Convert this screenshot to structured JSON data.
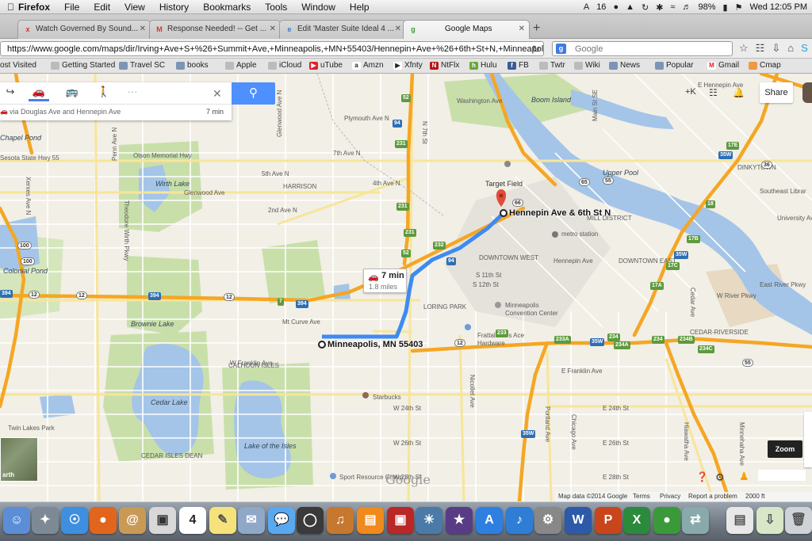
{
  "menubar": {
    "app": "Firefox",
    "items": [
      "File",
      "Edit",
      "View",
      "History",
      "Bookmarks",
      "Tools",
      "Window",
      "Help"
    ],
    "status": {
      "num": "16",
      "battery": "98%",
      "clock": "Wed 12:05 PM"
    }
  },
  "tabs": [
    {
      "label": "Watch Governed By Sound...",
      "fav": "x"
    },
    {
      "label": "Response Needed! -- Get ...",
      "fav": "M"
    },
    {
      "label": "Edit 'Master Suite Ideal 4 ...",
      "fav": "e"
    },
    {
      "label": "Google Maps",
      "fav": "g"
    }
  ],
  "nav": {
    "url": "https://www.google.com/maps/dir/Irving+Ave+S+%26+Summit+Ave,+Minneapolis,+MN+55403/Hennepin+Ave+%26+6th+St+N,+Minneapolis",
    "search_placeholder": "Google"
  },
  "bookmarks": [
    "ost Visited",
    "Getting Started",
    "Travel SC",
    "books",
    "Apple",
    "iCloud",
    "uTube",
    "Amzn",
    "Xfnty",
    "NtFlx",
    "Hulu",
    "FB",
    "Twtr",
    "Wiki",
    "News",
    "Popular",
    "Gmail",
    "Cmap"
  ],
  "directions": {
    "via": "via Douglas Ave and Hennepin Ave",
    "time": "7 min",
    "search_label": "Search"
  },
  "top_controls": {
    "plusk": "+K",
    "share": "Share"
  },
  "bubble": {
    "time": "7 min",
    "distance": "1.8 miles"
  },
  "markers": {
    "origin": "Minneapolis, MN 55403",
    "destination": "Hennepin Ave & 6th St N"
  },
  "places": {
    "areas": [
      "Boom Island",
      "Upper Pool",
      "Target Field",
      "metro station",
      "MILL DISTRICT",
      "DOWNTOWN WEST",
      "DOWNTOWN EAST",
      "LORING PARK",
      "Minneapolis Convention Center",
      "Frattallone's Ace Hardware",
      "Starbucks",
      "Sport Resource Group",
      "Cedar Lake",
      "Lake of the Isles",
      "Brownie Lake",
      "Wirth Lake",
      "Colonial Pond",
      "Twin Lakes Park",
      "DINKYTOWN",
      "Southeast Librar",
      "CEDAR-RIVERSIDE",
      "CALHOUN ISLES",
      "CEDAR ISLES DEAN",
      "HARRISON",
      "University Ave",
      "East River Pkwy",
      "W River Pkwy"
    ],
    "streets": [
      "Olson Memorial Hwy",
      "Glenwood Ave",
      "2nd Ave N",
      "4th Ave N",
      "5th Ave N",
      "7th Ave N",
      "Mt Curve Ave",
      "W Franklin Ave",
      "E Franklin Ave",
      "E 24th St",
      "E 26th St",
      "E 28th St",
      "W 24th St",
      "W 26th St",
      "W 28th St",
      "Hennepin Ave",
      "S 11th St",
      "S 12th St",
      "Penn Ave N",
      "Theodore Wirth Pkwy",
      "Cedar Ave",
      "Portland Ave",
      "Chicago Ave",
      "Nicollet Ave",
      "Minnehaha Ave",
      "Hiawatha Ave",
      "Main St SE",
      "E Hennepin Ave",
      "Sesota State Hwy 55",
      "Chapel Pond",
      "Xerxes Ave N",
      "Washington Ave",
      "N 7th St",
      "Plymouth Ave N",
      "Glenwood Ave N"
    ],
    "shields": [
      "94",
      "94",
      "394",
      "394",
      "394",
      "35W",
      "35W",
      "35W",
      "35W",
      "55",
      "55",
      "65",
      "52",
      "52",
      "12",
      "12",
      "12",
      "12",
      "7",
      "231",
      "231",
      "231",
      "232",
      "233",
      "233A",
      "234",
      "234A",
      "234C",
      "234B",
      "234",
      "17A",
      "17B",
      "17C",
      "17E",
      "18",
      "36",
      "66",
      "100",
      "100"
    ]
  },
  "map_footer": {
    "data": "Map data ©2014 Google",
    "terms": "Terms",
    "privacy": "Privacy",
    "report": "Report a problem",
    "scale": "2000 ft",
    "zoom_tip": "Zoom",
    "earth": "arth",
    "logo": "Google"
  },
  "colors": {
    "route": "#3d8bf2",
    "highway": "#f5a623",
    "water": "#a4c5e8",
    "park": "#c9dfaa",
    "land": "#f2efe6"
  },
  "dock": [
    "Finder",
    "Launchpad",
    "Safari",
    "Firefox",
    "Contacts",
    "Preview",
    "Calendar",
    "Stickies",
    "Mail",
    "Messages",
    "FaceTime",
    "GarageBand",
    "iBooks",
    "Photo Booth",
    "iPhoto",
    "iMovie",
    "App Store",
    "iTunes",
    "System Preferences",
    "Word",
    "PowerPoint",
    "Excel",
    "Google Maps",
    "Network",
    "Documents",
    "Downloads",
    "Trash"
  ]
}
